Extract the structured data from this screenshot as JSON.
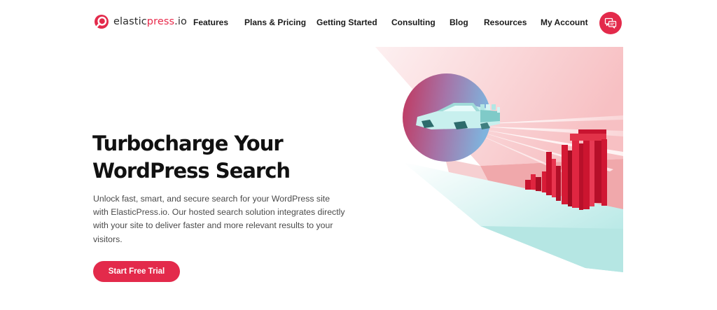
{
  "brand": {
    "name_prefix": "elastic",
    "name_accent": "press",
    "name_suffix": ".io",
    "accent_color": "#e32a4b",
    "logo_icon": "elasticpress-logo-icon"
  },
  "nav": {
    "items": [
      {
        "label": "Features"
      },
      {
        "label": "Plans & Pricing"
      },
      {
        "label": "Getting Started"
      },
      {
        "label": "Consulting"
      },
      {
        "label": "Blog"
      },
      {
        "label": "Resources"
      },
      {
        "label": "My Account"
      }
    ],
    "chat_icon": "chat-bubbles-icon"
  },
  "hero": {
    "title_line1": "Turbocharge Your",
    "title_line2": "WordPress Search",
    "description": "Unlock fast, smart, and secure search for your WordPress site with ElasticPress.io. Our hosted search solution integrates directly with your site to deliver faster and more relevant results to your visitors.",
    "cta_label": "Start Free Trial"
  }
}
